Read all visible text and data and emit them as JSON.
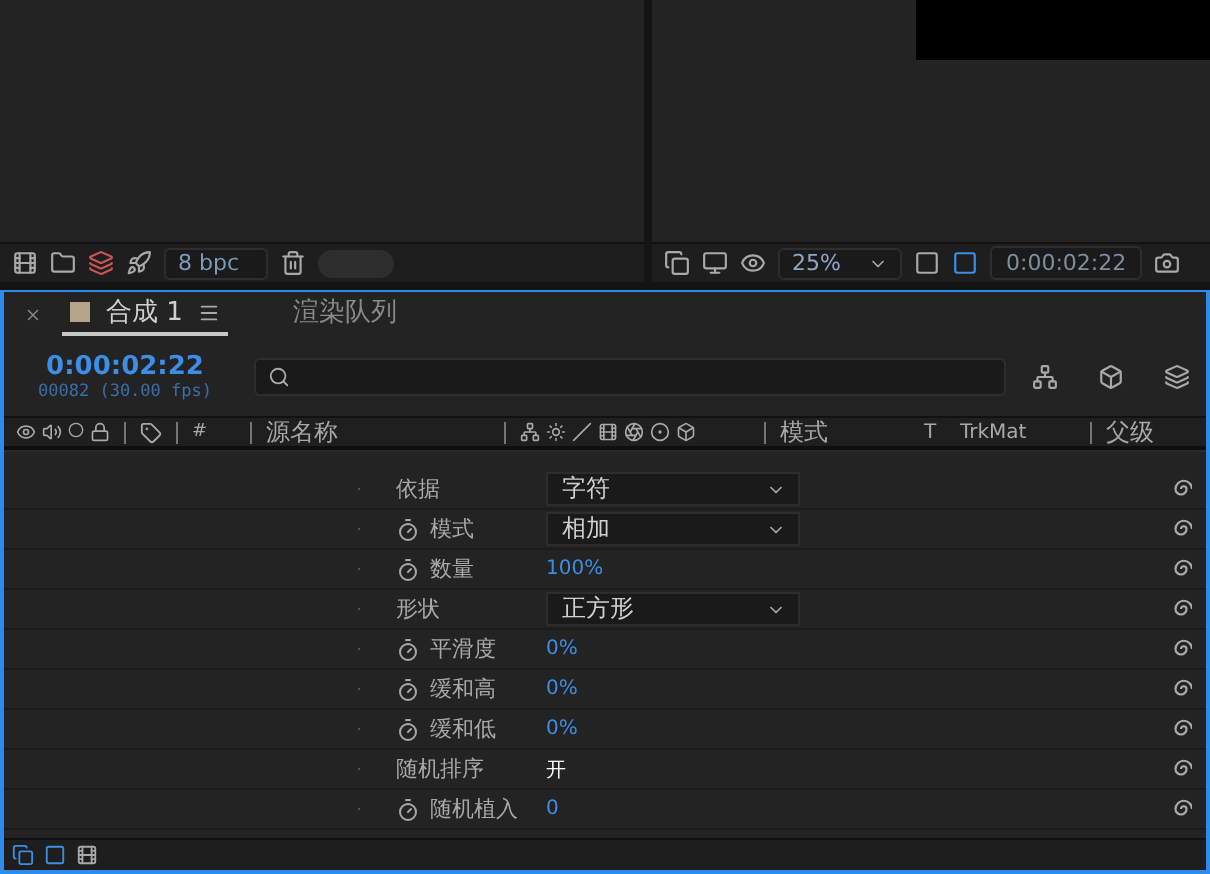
{
  "left_toolbar": {
    "bpc": "8 bpc"
  },
  "viewer_toolbar": {
    "zoom": "25%",
    "timecode": "0:00:02:22"
  },
  "tabs": [
    {
      "label": "合成 1",
      "selected": true,
      "color": "#b5a588"
    },
    {
      "label": "渲染队列",
      "selected": false
    }
  ],
  "timeline": {
    "current_time": "0:00:02:22",
    "frame_info": "00082 (30.00 fps)"
  },
  "columns": {
    "number": "#",
    "source_name": "源名称",
    "mode": "模式",
    "t": "T",
    "trkmat": "TrkMat",
    "parent": "父级"
  },
  "properties": [
    {
      "name": "依据",
      "kind": "dropdown",
      "stopwatch": false,
      "value": "字符"
    },
    {
      "name": "模式",
      "kind": "dropdown",
      "stopwatch": true,
      "value": "相加"
    },
    {
      "name": "数量",
      "kind": "number",
      "stopwatch": true,
      "value": "100%"
    },
    {
      "name": "形状",
      "kind": "dropdown",
      "stopwatch": false,
      "value": "正方形"
    },
    {
      "name": "平滑度",
      "kind": "number",
      "stopwatch": true,
      "value": "0%"
    },
    {
      "name": "缓和高",
      "kind": "number",
      "stopwatch": true,
      "value": "0%"
    },
    {
      "name": "缓和低",
      "kind": "number",
      "stopwatch": true,
      "value": "0%"
    },
    {
      "name": "随机排序",
      "kind": "toggle",
      "stopwatch": false,
      "value": "开"
    },
    {
      "name": "随机植入",
      "kind": "number",
      "stopwatch": true,
      "value": "0"
    }
  ]
}
